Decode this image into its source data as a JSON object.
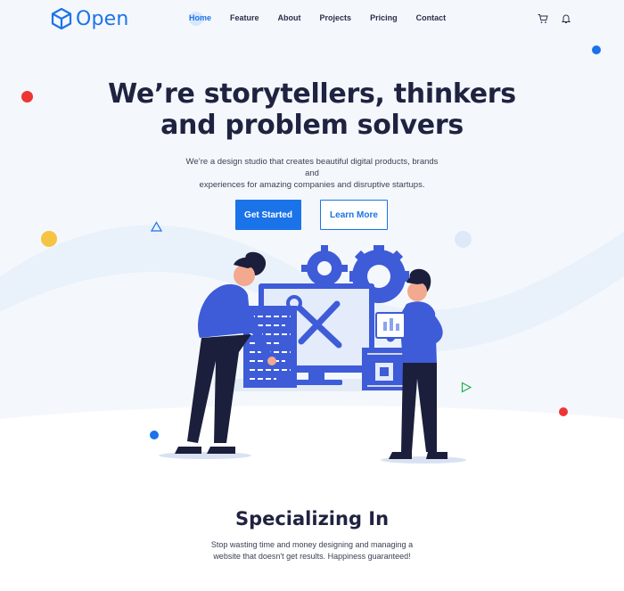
{
  "header": {
    "logo_text": "Open",
    "nav": [
      {
        "label": "Home",
        "active": true
      },
      {
        "label": "Feature"
      },
      {
        "label": "About"
      },
      {
        "label": "Projects"
      },
      {
        "label": "Pricing"
      },
      {
        "label": "Contact"
      }
    ],
    "icons": [
      "cart-icon",
      "bell-icon"
    ]
  },
  "hero": {
    "title_line1": "We’re storytellers, thinkers",
    "title_line2": "and problem solvers",
    "subtitle_line1": "We’re a design studio that creates beautiful digital products, brands and",
    "subtitle_line2": "experiences for amazing companies and disruptive startups.",
    "primary_button": "Get Started",
    "secondary_button": "Learn More"
  },
  "section": {
    "title": "Specializing In",
    "subtitle_line1": "Stop wasting time and money designing and managing a",
    "subtitle_line2": "website that doesn't get results. Happiness guaranteed!"
  },
  "colors": {
    "accent": "#1a73e8",
    "dark": "#1f2340",
    "red": "#ee3535",
    "yellow": "#f6c343",
    "illustration_blue": "#3e5bd8"
  }
}
